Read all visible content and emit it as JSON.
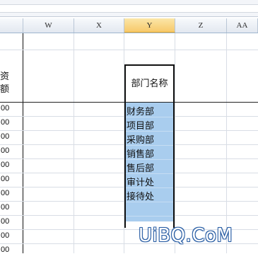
{
  "columns": [
    {
      "label": "W"
    },
    {
      "label": "X"
    },
    {
      "label": "Y",
      "selected": true
    },
    {
      "label": "Z"
    },
    {
      "label": "AA"
    }
  ],
  "left_column": {
    "header_partial": [
      "资",
      "额"
    ],
    "values": [
      "00",
      "00",
      "00",
      "00",
      "00",
      "00",
      "00",
      "00",
      "00",
      "00",
      "00"
    ]
  },
  "table": {
    "header": "部门名称",
    "items": [
      "财务部",
      "项目部",
      "采购部",
      "销售部",
      "售后部",
      "审计处",
      "接待处"
    ]
  },
  "watermark": "UiBQ.CoM",
  "colors": {
    "selection_fill": "#a9cdee",
    "selected_header": "#f7c96a",
    "grid_line": "#d8dde5"
  }
}
